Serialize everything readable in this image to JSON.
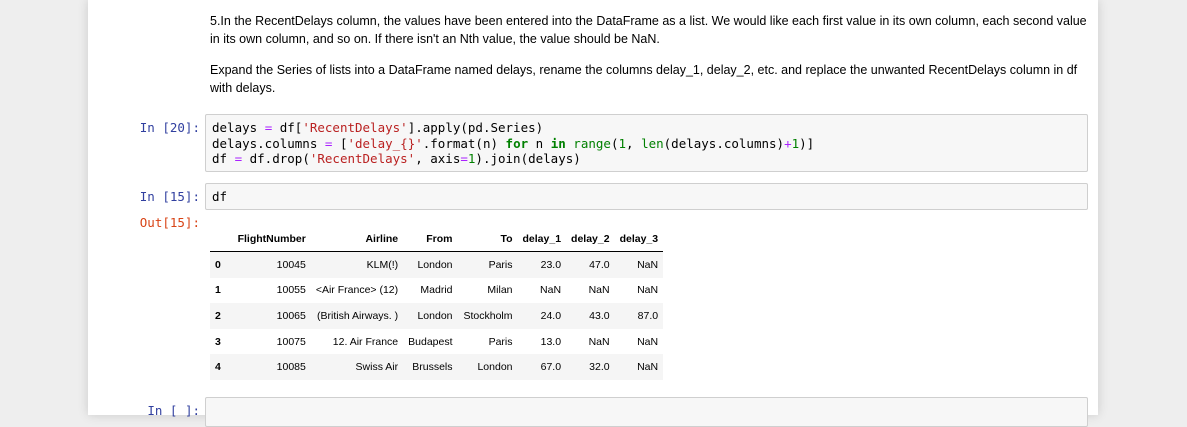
{
  "markdown": {
    "paragraph1": "5.In the RecentDelays column, the values have been entered into the DataFrame as a list. We would like each first value in its own column, each second value in its own column, and so on. If there isn't an Nth value, the value should be NaN.",
    "paragraph2": "Expand the Series of lists into a DataFrame named delays, rename the columns delay_1, delay_2, etc. and replace the unwanted RecentDelays column in df with delays."
  },
  "cells": [
    {
      "prompt": "In [20]:"
    },
    {
      "prompt": "In [15]:",
      "code": "df",
      "out_prompt": "Out[15]:"
    },
    {
      "prompt": "In [ ]:"
    }
  ],
  "table": {
    "columns": [
      "FlightNumber",
      "Airline",
      "From",
      "To",
      "delay_1",
      "delay_2",
      "delay_3"
    ],
    "rows": [
      {
        "index": "0",
        "cells": [
          "10045",
          "KLM(!)",
          "London",
          "Paris",
          "23.0",
          "47.0",
          "NaN"
        ]
      },
      {
        "index": "1",
        "cells": [
          "10055",
          "<Air France> (12)",
          "Madrid",
          "Milan",
          "NaN",
          "NaN",
          "NaN"
        ]
      },
      {
        "index": "2",
        "cells": [
          "10065",
          "(British Airways. )",
          "London",
          "Stockholm",
          "24.0",
          "43.0",
          "87.0"
        ]
      },
      {
        "index": "3",
        "cells": [
          "10075",
          "12. Air France",
          "Budapest",
          "Paris",
          "13.0",
          "NaN",
          "NaN"
        ]
      },
      {
        "index": "4",
        "cells": [
          "10085",
          "Swiss Air",
          "Brussels",
          "London",
          "67.0",
          "32.0",
          "NaN"
        ]
      }
    ]
  },
  "colors": {
    "in_prompt": "#303f9f",
    "out_prompt": "#d84315",
    "keyword": "#008000",
    "string": "#ba2121",
    "operator": "#aa22ff"
  }
}
